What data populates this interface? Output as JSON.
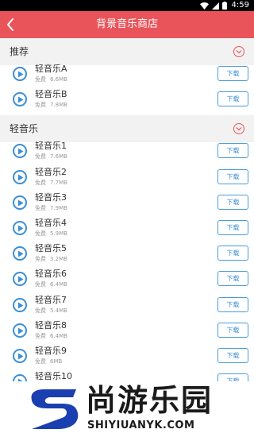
{
  "status_bar": {
    "time": "4:59"
  },
  "header": {
    "title": "背景音乐商店"
  },
  "sections": [
    {
      "label": "推荐",
      "tracks": [
        {
          "name": "轻音乐A",
          "price": "免费",
          "size": "6.6MB",
          "download_label": "下载"
        },
        {
          "name": "轻音乐B",
          "price": "免费",
          "size": "7.8MB",
          "download_label": "下载"
        }
      ]
    },
    {
      "label": "轻音乐",
      "tracks": [
        {
          "name": "轻音乐1",
          "price": "免费",
          "size": "7.6MB",
          "download_label": "下载"
        },
        {
          "name": "轻音乐2",
          "price": "免费",
          "size": "7.7MB",
          "download_label": "下载"
        },
        {
          "name": "轻音乐3",
          "price": "免费",
          "size": "7.9MB",
          "download_label": "下载"
        },
        {
          "name": "轻音乐4",
          "price": "免费",
          "size": "5.9MB",
          "download_label": "下载"
        },
        {
          "name": "轻音乐5",
          "price": "免费",
          "size": "3.2MB",
          "download_label": "下载"
        },
        {
          "name": "轻音乐6",
          "price": "免费",
          "size": "6.4MB",
          "download_label": "下载"
        },
        {
          "name": "轻音乐7",
          "price": "免费",
          "size": "5.4MB",
          "download_label": "下载"
        },
        {
          "name": "轻音乐8",
          "price": "免费",
          "size": "6.4MB",
          "download_label": "下载"
        },
        {
          "name": "轻音乐9",
          "price": "免费",
          "size": "6MB",
          "download_label": "下载"
        },
        {
          "name": "轻音乐10",
          "price": "",
          "size": "",
          "download_label": "下载"
        }
      ]
    }
  ],
  "watermark": {
    "brand": "尚游乐园",
    "site": "SHIYIUANYK.COM"
  },
  "colors": {
    "accent": "#e9545a",
    "link": "#3a8fd6",
    "section_bg": "#f2f2f2"
  }
}
